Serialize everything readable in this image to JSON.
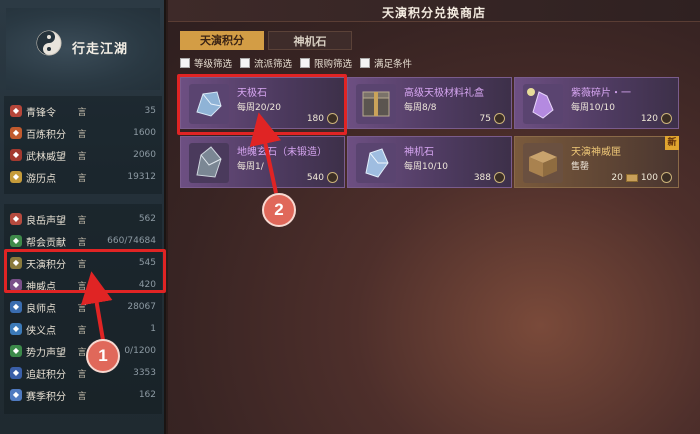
{
  "sidebar": {
    "title": "行走江湖",
    "group1": [
      {
        "label": "青锋令",
        "value": "35",
        "icon": "sword-token-icon",
        "color": "#b5463a"
      },
      {
        "label": "百炼积分",
        "value": "1600",
        "icon": "forge-icon",
        "color": "#c05a2e"
      },
      {
        "label": "武林威望",
        "value": "2060",
        "icon": "crossed-swords-icon",
        "color": "#a4392f"
      },
      {
        "label": "游历点",
        "value": "19312",
        "icon": "scroll-icon",
        "color": "#c59b3a"
      }
    ],
    "group2": [
      {
        "label": "良岳声望",
        "value": "562",
        "icon": "mountain-icon",
        "color": "#b64a3e"
      },
      {
        "label": "帮会贡献",
        "value": "660/74684",
        "icon": "guild-icon",
        "color": "#3f8a4a"
      },
      {
        "label": "天演积分",
        "value": "545",
        "icon": "tianyan-icon",
        "color": "#8a7a3c"
      },
      {
        "label": "神威点",
        "value": "420",
        "icon": "shenwei-icon",
        "color": "#7a4f8a"
      },
      {
        "label": "良师点",
        "value": "28067",
        "icon": "teacher-icon",
        "color": "#3a6db0"
      },
      {
        "label": "侠义点",
        "value": "1",
        "icon": "righteous-icon",
        "color": "#3c7ab8"
      },
      {
        "label": "势力声望",
        "value": "0/1200",
        "icon": "faction-icon",
        "color": "#3c8a4a"
      },
      {
        "label": "追赶积分",
        "value": "3353",
        "icon": "catchup-icon",
        "color": "#3a5fa8"
      },
      {
        "label": "赛季积分",
        "value": "162",
        "icon": "season-icon",
        "color": "#4f7ac0"
      }
    ],
    "info_glyph": "言"
  },
  "main": {
    "title": "天演积分兑换商店",
    "tabs": [
      {
        "label": "天演积分",
        "active": true
      },
      {
        "label": "神机石",
        "active": false
      }
    ],
    "filters": [
      {
        "label": "等级筛选",
        "checked": false
      },
      {
        "label": "流派筛选",
        "checked": false
      },
      {
        "label": "限购筛选",
        "checked": false
      },
      {
        "label": "满足条件",
        "checked": false
      }
    ],
    "items": [
      {
        "name": "天极石",
        "limit": "每周20/20",
        "price": "180",
        "style": "purple",
        "icon": "tianji-stone-icon"
      },
      {
        "name": "高级天极材料礼盒",
        "limit": "每周8/8",
        "price": "75",
        "style": "purple",
        "icon": "gift-box-icon"
      },
      {
        "name": "紫薇碎片・一",
        "limit": "每周10/10",
        "price": "120",
        "style": "purple",
        "icon": "purple-shard-icon"
      },
      {
        "name": "地魄玄石（未锻造）",
        "limit": "每周1/",
        "price": "540",
        "style": "purple",
        "icon": "dipo-stone-icon"
      },
      {
        "name": "神机石",
        "limit": "每周10/10",
        "price": "388",
        "style": "purple",
        "icon": "shenji-stone-icon"
      },
      {
        "name": "天演神威匣",
        "limit": "售罄",
        "price": "20",
        "price2": "100",
        "style": "gold",
        "icon": "crate-icon",
        "badge": "新"
      }
    ]
  },
  "annotations": {
    "callout1": "1",
    "callout2": "2",
    "highlight_color": "#e02424"
  }
}
